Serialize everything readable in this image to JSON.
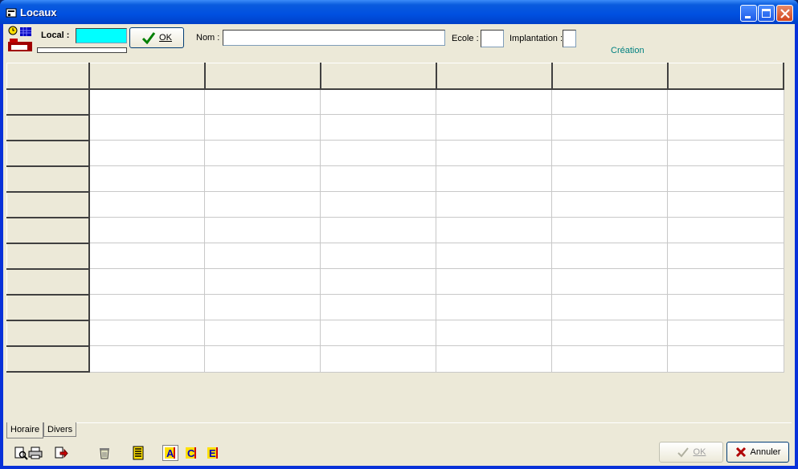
{
  "window": {
    "title": "Locaux"
  },
  "header": {
    "local_label": "Local :",
    "local_value": "",
    "ok_label": "OK",
    "nom_label": "Nom :",
    "nom_value": "",
    "ecole_label": "Ecole :",
    "ecole_value": "",
    "implantation_label": "Implantation :",
    "implantation_value": "",
    "status": "Création"
  },
  "grid": {
    "columns": 6,
    "rows": 11
  },
  "tabs": [
    {
      "label": "Horaire",
      "active": true
    },
    {
      "label": "Divers",
      "active": false
    }
  ],
  "toolbar": {
    "icons": [
      "preview-icon",
      "print-icon",
      "export-icon",
      "recycle-icon",
      "list-icon",
      "letter-a-icon",
      "letter-c-icon",
      "letter-e-icon"
    ]
  },
  "footer": {
    "ok_label": "OK",
    "cancel_label": "Annuler"
  },
  "colors": {
    "local_field": "#00ffff",
    "status_text": "#008080",
    "titlebar": "#0a5cde"
  }
}
